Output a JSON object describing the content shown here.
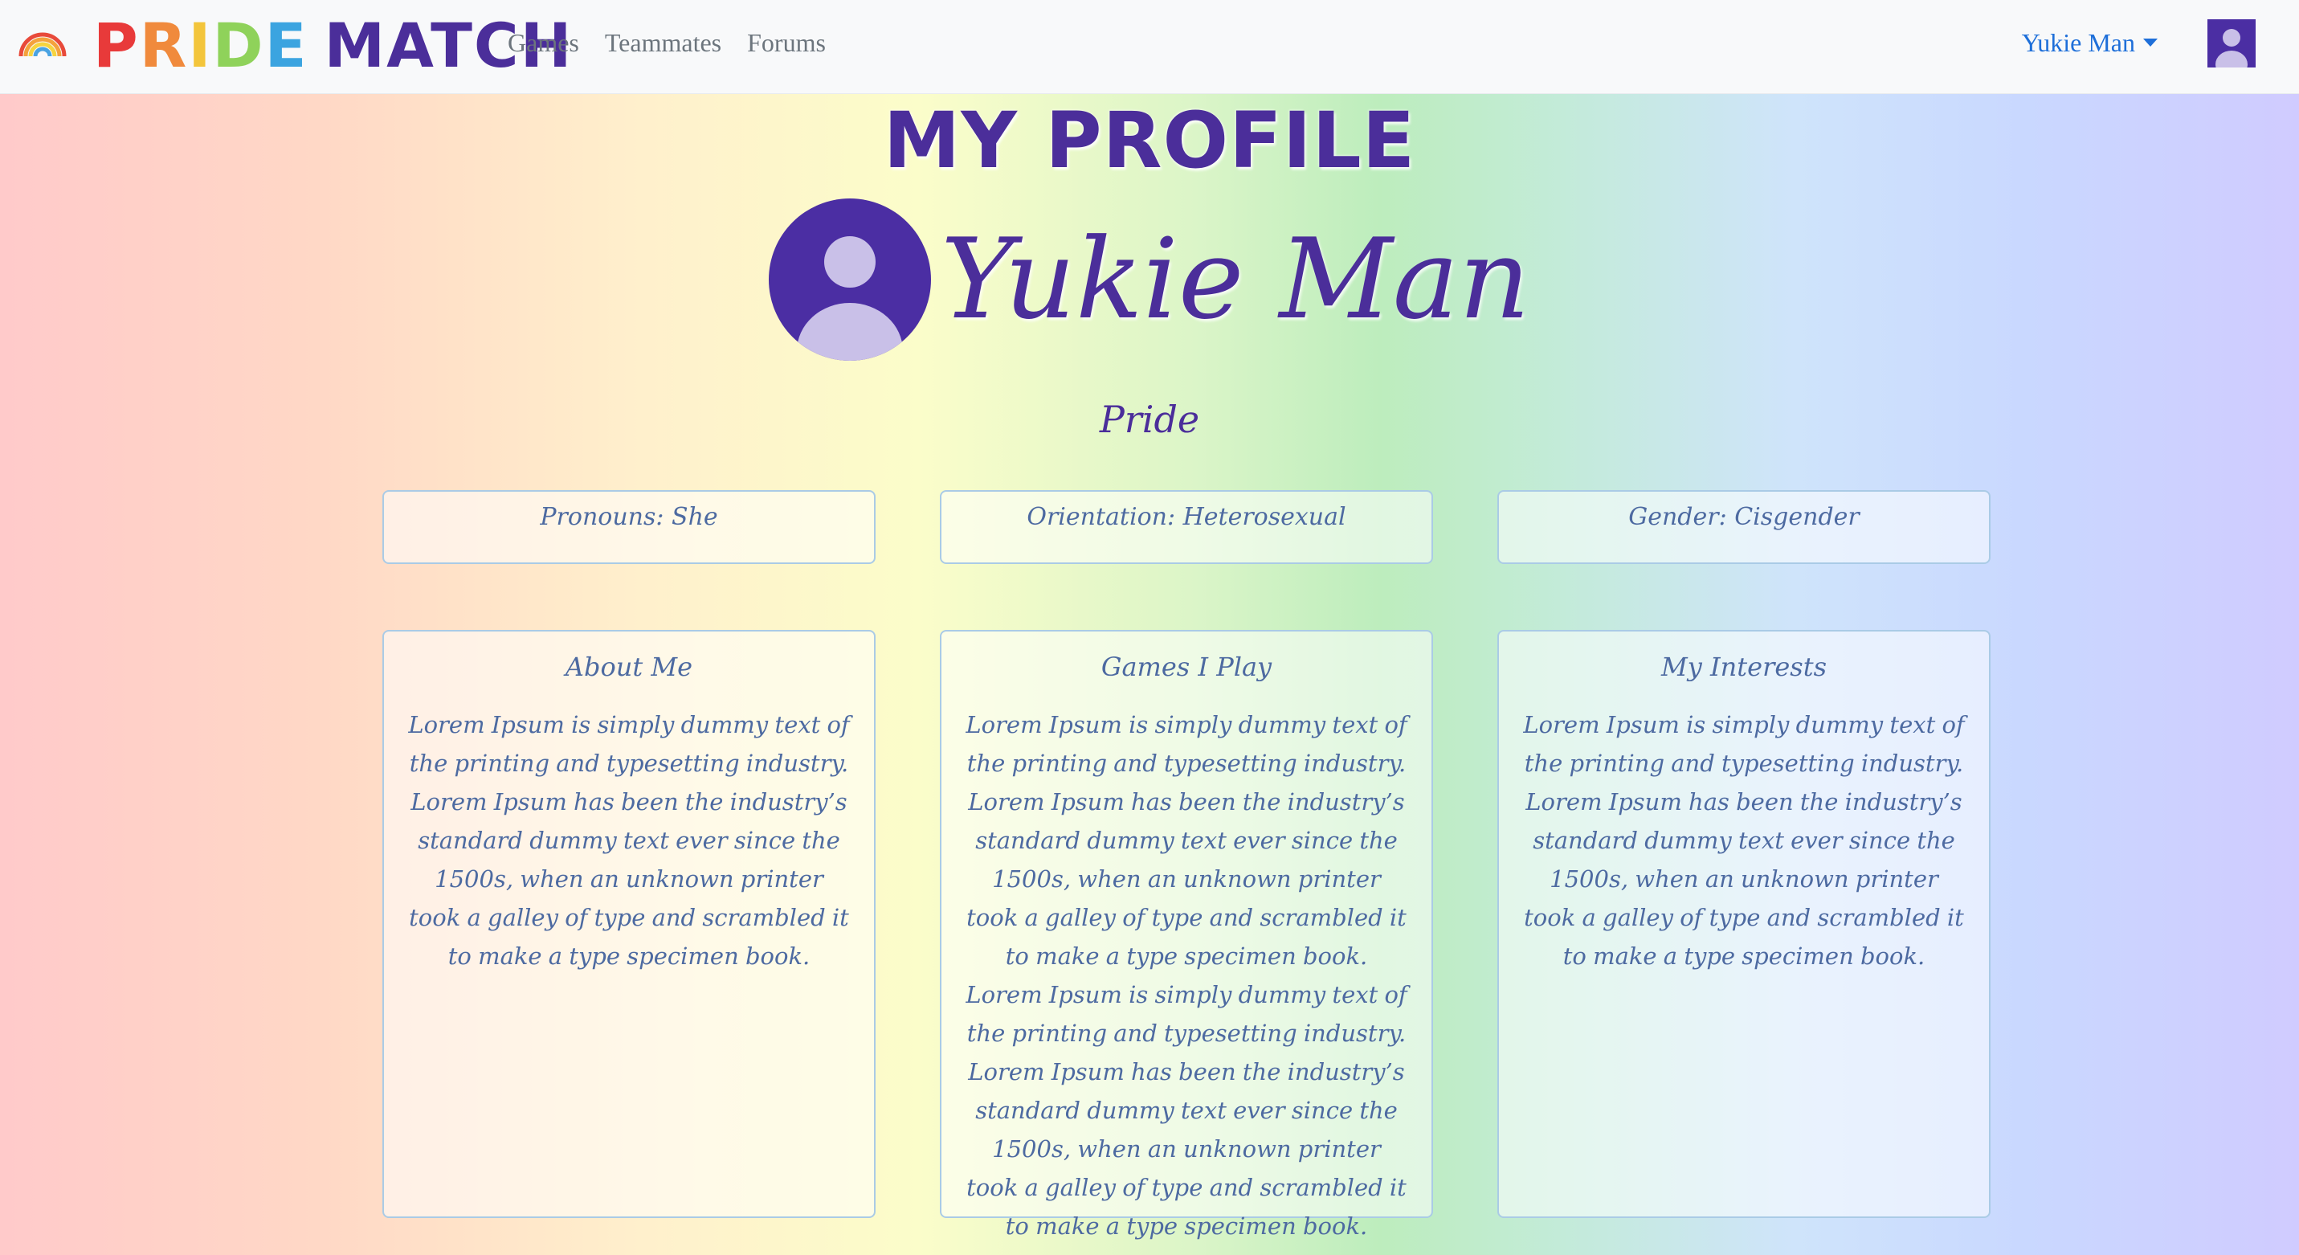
{
  "nav": {
    "brand_letters": [
      {
        "char": "P",
        "color": "#e83a3a"
      },
      {
        "char": "R",
        "color": "#f08a3c"
      },
      {
        "char": "I",
        "color": "#f3c53b"
      },
      {
        "char": "D",
        "color": "#8fd25a"
      },
      {
        "char": "E",
        "color": "#3ba4e0"
      }
    ],
    "brand_second_word": "MATCH",
    "brand_second_color": "#4b2e9a",
    "links": [
      "Games",
      "Teammates",
      "Forums"
    ],
    "user_name": "Yukie Man"
  },
  "page": {
    "title": "MY PROFILE",
    "profile_name": "Yukie Man",
    "subtitle": "Pride"
  },
  "info": {
    "pronouns": "Pronouns: She",
    "orientation": "Orientation: Heterosexual",
    "gender": "Gender: Cisgender"
  },
  "sections": {
    "about": {
      "title": "About Me",
      "body": "Lorem Ipsum is simply dummy text of the printing and typesetting industry. Lorem Ipsum has been the industry’s standard dummy text ever since the 1500s, when an unknown printer took a galley of type and scrambled it to make a type specimen book."
    },
    "games": {
      "title": "Games I Play",
      "body": "Lorem Ipsum is simply dummy text of the printing and typesetting industry. Lorem Ipsum has been the industry’s standard dummy text ever since the 1500s, when an unknown printer took a galley of type and scrambled it to make a type specimen book. Lorem Ipsum is simply dummy text of the printing and typesetting industry. Lorem Ipsum has been the industry’s standard dummy text ever since the 1500s, when an unknown printer took a galley of type and scrambled it to make a type specimen book."
    },
    "interests": {
      "title": "My Interests",
      "body": "Lorem Ipsum is simply dummy text of the printing and typesetting industry. Lorem Ipsum has been the industry’s standard dummy text ever since the 1500s, when an unknown printer took a galley of type and scrambled it to make a type specimen book."
    }
  },
  "icons": {
    "logo": "rainbow-icon",
    "avatar": "user-avatar-icon",
    "dropdown": "caret-down-icon"
  },
  "colors": {
    "accent_purple": "#4b2e9a",
    "avatar_bg": "#4b2ea3",
    "avatar_figure": "#c9c0e8",
    "link_blue": "#1e6fd9",
    "card_text": "#4d6aa1",
    "card_border": "#aacbe6"
  }
}
